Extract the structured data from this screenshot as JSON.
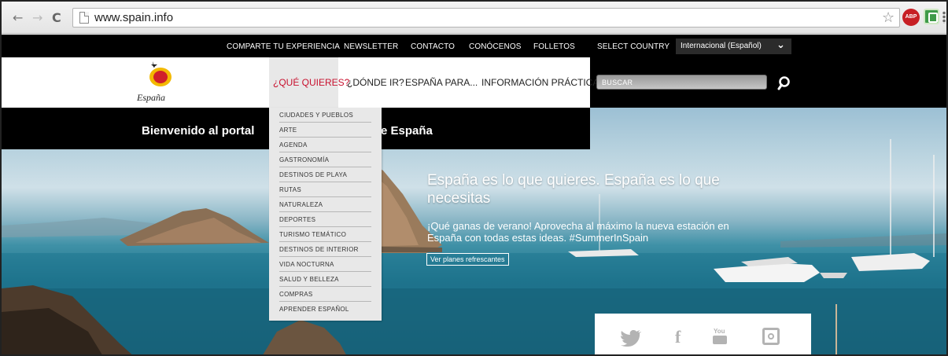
{
  "browser": {
    "url": "www.spain.info",
    "back_icon": "←",
    "forward_icon": "→",
    "reload_icon": "C",
    "star_icon": "☆",
    "abp_label": "ABP"
  },
  "topbar": {
    "links": [
      "COMPARTE TU EXPERIENCIA",
      "NEWSLETTER",
      "CONTACTO",
      "CONÓCENOS",
      "FOLLETOS",
      "SELECT COUNTRY"
    ],
    "country_value": "Internacional (Español)"
  },
  "header": {
    "logo_text": "España",
    "nav": [
      "¿QUÉ QUIERES?",
      "¿DÓNDE IR?",
      "ESPAÑA PARA...",
      "INFORMACIÓN PRÁCTICA"
    ],
    "search_placeholder": "BUSCAR"
  },
  "dropdown": {
    "items": [
      "CIUDADES Y PUEBLOS",
      "ARTE",
      "AGENDA",
      "GASTRONOMÍA",
      "DESTINOS DE PLAYA",
      "RUTAS",
      "NATURALEZA",
      "DEPORTES",
      "TURISMO TEMÁTICO",
      "DESTINOS DE INTERIOR",
      "VIDA NOCTURNA",
      "SALUD Y BELLEZA",
      "COMPRAS",
      "APRENDER ESPAÑOL"
    ]
  },
  "welcome": {
    "left": "Bienvenido al portal",
    "right": "e España"
  },
  "hero": {
    "title": "España es lo que quieres. España es lo que necesitas",
    "subtitle": "¡Qué ganas de verano! Aprovecha al máximo la nueva estación en España con todas estas ideas. #SummerInSpain",
    "cta": "Ver planes refrescantes"
  },
  "social": {
    "icons": [
      "twitter-icon",
      "facebook-icon",
      "youtube-icon",
      "instagram-icon"
    ],
    "facebook_glyph": "f",
    "youtube_glyph": "You"
  },
  "colors": {
    "accent_red": "#c8102e",
    "logo_yellow": "#f3b900"
  }
}
